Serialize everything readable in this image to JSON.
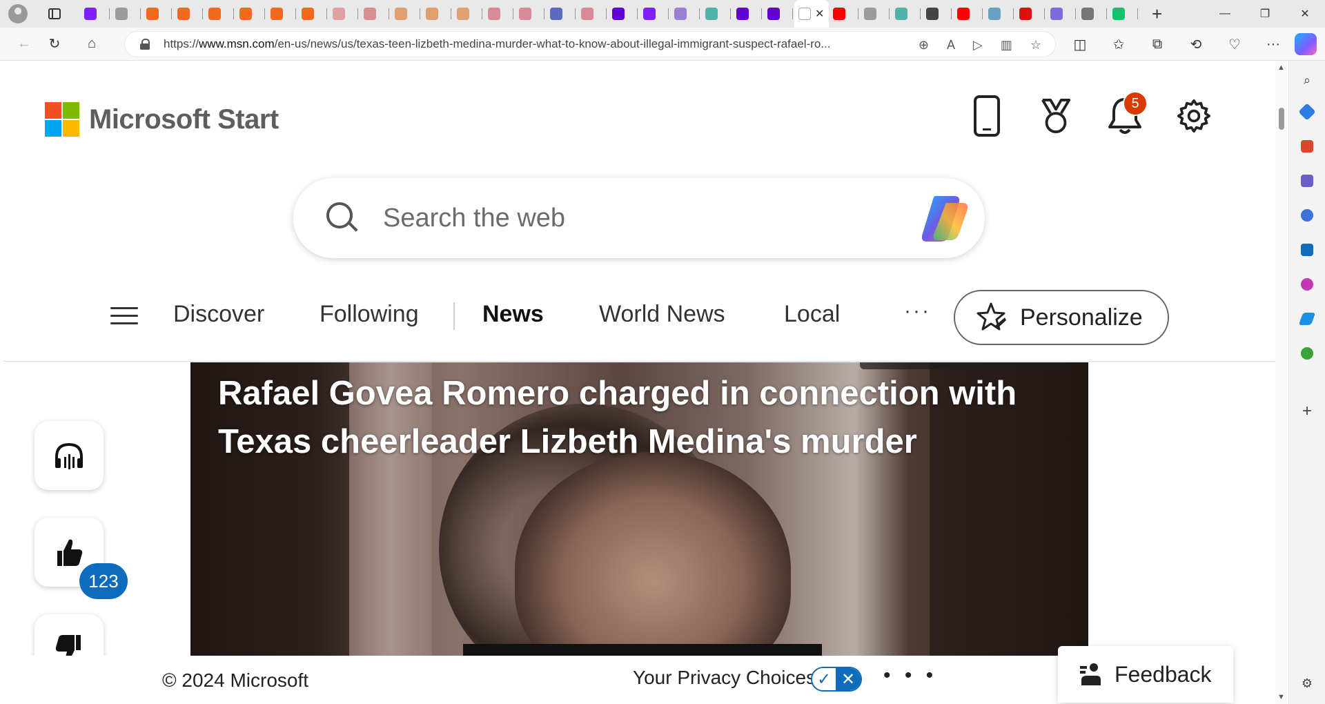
{
  "browser": {
    "url_prefix": "https://",
    "url_host": "www.msn.com",
    "url_path": "/en-us/news/us/texas-teen-lizbeth-medina-murder-what-to-know-about-illegal-immigrant-suspect-rafael-ro...",
    "active_tab_close": "✕",
    "new_tab": "+",
    "tab_favicon_colors": [
      "#7e1fff",
      "#9a9a9a",
      "#f06a1e",
      "#f06a1e",
      "#f06a1e",
      "#f06a1e",
      "#f06a1e",
      "#f06a1e",
      "#e0a0a0",
      "#d89090",
      "#e0a070",
      "#e0a070",
      "#e0a070",
      "#d88a9a",
      "#d88a9a",
      "#5c6bc0",
      "#d88a9a",
      "#5f01d1",
      "#7e1fff",
      "#9a7fd0",
      "#4fb3a9",
      "#5f01d1",
      "#5f01d1",
      "#ffffff",
      "#ff0000",
      "#9a9a9a",
      "#4fb3a9",
      "#444444",
      "#ff0000",
      "#6aa0c0",
      "#e01010",
      "#7d6bd6",
      "#777777",
      "#15c26b"
    ],
    "window_controls": [
      "—",
      "❐",
      "✕"
    ]
  },
  "header": {
    "brand": "Microsoft Start",
    "logo_colors": [
      "#f25022",
      "#7fba00",
      "#00a4ef",
      "#ffb900"
    ],
    "notification_count": "5"
  },
  "search": {
    "placeholder": "Search the web"
  },
  "nav": {
    "items": [
      {
        "label": "Discover",
        "active": false
      },
      {
        "label": "Following",
        "active": false
      },
      {
        "label": "News",
        "active": true
      },
      {
        "label": "World News",
        "active": false
      },
      {
        "label": "Local",
        "active": false
      }
    ],
    "more": "···",
    "personalize_label": "Personalize"
  },
  "article": {
    "title": "Rafael Govea Romero charged in connection with Texas cheerleader Lizbeth Medina's murder",
    "like_count": "123"
  },
  "footer": {
    "copyright": "© 2024 Microsoft",
    "privacy": "Your Privacy Choices",
    "more": "• • •",
    "feedback": "Feedback"
  },
  "colors": {
    "accent": "#0f6cbd",
    "badge": "#d83b01"
  }
}
